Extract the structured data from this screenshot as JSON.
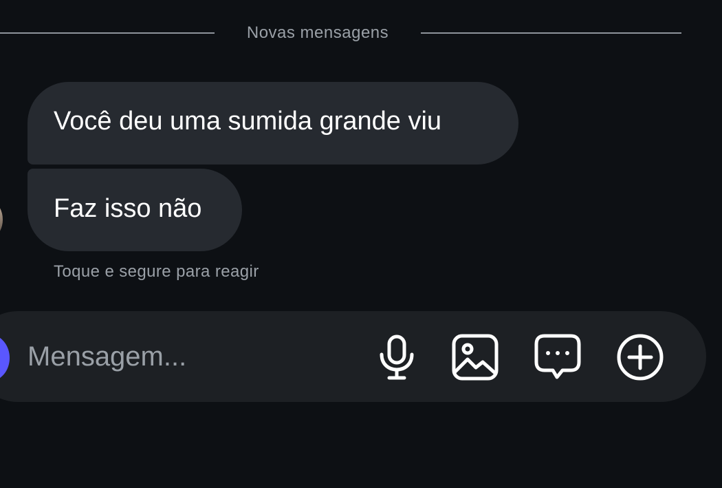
{
  "divider": {
    "label": "Novas mensagens"
  },
  "messages": [
    {
      "text": "Você deu uma sumida grande viu"
    },
    {
      "text": "Faz isso não"
    }
  ],
  "hint": {
    "text": "Toque e segure para reagir"
  },
  "composer": {
    "placeholder": "Mensagem...",
    "value": "",
    "buttons": [
      "microphone-icon",
      "image-icon",
      "chat-bubble-icon",
      "add-circle-icon"
    ]
  },
  "colors": {
    "background": "#0d1014",
    "bubble": "#262a30",
    "composer": "#1d2024",
    "muted_text": "#9aa0a7",
    "camera_accent": "#5a57ff"
  }
}
